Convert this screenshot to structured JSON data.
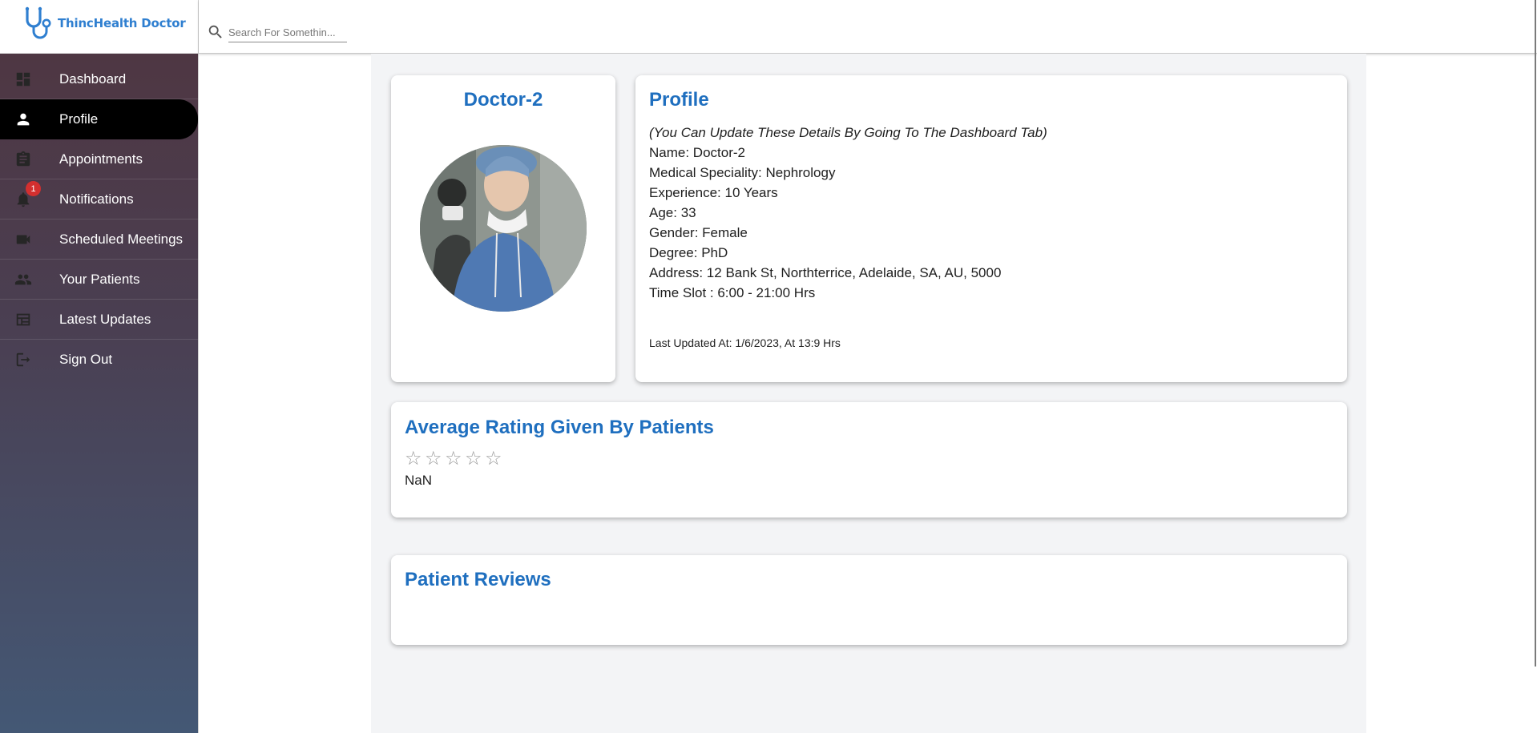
{
  "brand": {
    "name": "ThincHealth Doctor"
  },
  "search": {
    "placeholder": "Search For Somethin..."
  },
  "colors": {
    "accent": "#1f6fbf",
    "sidebar_top": "#4f3540",
    "sidebar_bottom": "#445875",
    "badge": "#d32f2f"
  },
  "sidebar": {
    "items": [
      {
        "label": "Dashboard",
        "icon": "dashboard-icon"
      },
      {
        "label": "Profile",
        "icon": "person-icon",
        "active": true
      },
      {
        "label": "Appointments",
        "icon": "clipboard-icon"
      },
      {
        "label": "Notifications",
        "icon": "bell-icon",
        "badge": "1"
      },
      {
        "label": "Scheduled Meetings",
        "icon": "videocam-icon"
      },
      {
        "label": "Your Patients",
        "icon": "people-icon"
      },
      {
        "label": "Latest Updates",
        "icon": "table-icon"
      },
      {
        "label": "Sign Out",
        "icon": "logout-icon"
      }
    ]
  },
  "doctor_card": {
    "name": "Doctor-2"
  },
  "profile": {
    "title": "Profile",
    "note": "(You Can Update These Details By Going To The Dashboard Tab)",
    "lines": [
      "Name: Doctor-2",
      "Medical Speciality: Nephrology",
      "Experience: 10 Years",
      "Age: 33",
      "Gender: Female",
      "Degree: PhD",
      "Address: 12 Bank St, Northterrice, Adelaide, SA, AU, 5000",
      "Time Slot : 6:00 - 21:00 Hrs"
    ],
    "last_updated": "Last Updated At: 1/6/2023, At 13:9 Hrs"
  },
  "rating": {
    "title": "Average Rating Given By Patients",
    "filled_stars": 0,
    "max_stars": 5,
    "value": "NaN"
  },
  "reviews": {
    "title": "Patient Reviews"
  }
}
